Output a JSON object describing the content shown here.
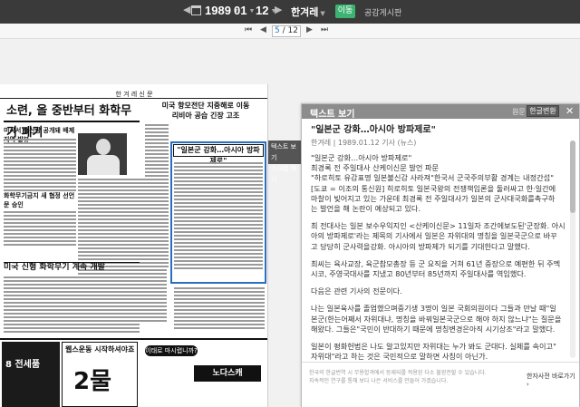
{
  "topbar": {
    "year": "1989",
    "month": "01",
    "day": "12",
    "paper": "한겨레",
    "move_label": "이동",
    "link_label": "공감게시판"
  },
  "navbar": {
    "current_page": "5",
    "total_pages": "/ 12"
  },
  "newspaper": {
    "header": "한 겨 레 신 문",
    "headline": "소련, 올 중반부터 화학무기 폐기",
    "headline2": "미국 항모전단 지중해로 이동",
    "headline2_sub": "리비아 공습 긴장 고조",
    "sub1": "미국서 생산량 공개돼 배제지역 발뷰",
    "sub2": "화학무기금지 새 협정 선언문 승인",
    "sub3": "미국 신형 화학무기 계속 개발",
    "highlight_title": "\"일본군 강화…아시아 방파제로\"",
    "ad_left": "8 전세품",
    "ad_mid_title": "웹스운동 시작하셔야죠",
    "ad_mid_big": "2물",
    "ad_right_badge": "이태로 마시렵니까?",
    "ad_right_brand": "노다스캐"
  },
  "tooltip": {
    "line1": "텍스트 보기",
    "line2": "스크랩 하기"
  },
  "panel": {
    "title": "텍스트 보기",
    "orig_label": "원문",
    "convert_label": "한글변환",
    "close_label": "✕",
    "article_title": "\"일본군 강화…아시아 방파제로\"",
    "article_meta": "한겨레 | 1989.01.12 기사 (뉴스)",
    "p1_l1": "\"일본군 강화…아시아 방파제로\"",
    "p1_l2": "최경록 전 주일대사 산케이신문 발언 파문",
    "p1_l3": "\"하로히토 유감표명 일본불신감 사라져\"한국서 군국주의부활 경계는 내정간섭\"",
    "p1_l4": "[도쿄 = 이조의 통신원] 히로히토 일본국왕의 전쟁책임론을 둘러싸고 한·일간에",
    "p1_l5": "마찰이 빚어지고 있는 가운데 최경록 전 주일대사가 일본의 군사대국화를촉구하",
    "p1_l6": "는 발언을 해 논란이 예상되고 있다.",
    "p2_l1": "최 전대사는 일본 보수우익지인 <산케이신문> 11일자 조간에보도된'군장화. 아시",
    "p2_l2": "아의 방파제로'라는 제목의 기사에서 일본은 자위대의 명칭을 일본국군으로 바꾸",
    "p2_l3": "고 당당히 군사력을강화. 아시아의 방파제가 되기를 기대한다고 말했다.",
    "p3_l1": "최씨는 육사교장, 육군참모총장 등 군 요직을 거쳐 61년 중장으로 예편한 뒤 주멕",
    "p3_l2": "시코, 주영국대사를 지냈고 80년부터 85년까지 주일대사를 역임했다.",
    "p4_l1": "다음은 관련 기사의 전문이다.",
    "p5_l1": "나는 일본육사를 졸업했으며중기생 3명이 일본 국회의원이다 그들과 만날 때\"일",
    "p5_l2": "본군(한는어째서 자위대냐, 명칭을 바꿔일본국군으로 해야 하지 않느냐\"는 질문을",
    "p5_l3": "해왔다. 그들은\"국민이 반대하기 때문에 명칭변경은아직 시기상조\"라고 말했다.",
    "p6_l1": "일본이 평화헌법은 나도 알고있지만 자위대는 누가 봐도 군대다. 실체를 속이고\"",
    "p6_l2": "자위대\"라고 하는 것은 국민적으로 말하면 사칭이 아닌가.",
    "foot1": "한국의 한글번역 시 무용합격에서 등재되를 적용된 다소 불완전할 수 있습니다.",
    "foot2": "지속적인 연구를 통해 보다 나은 서비스를 만들어 가겠습니다.",
    "foot_link": "한자사전 바로가기 ›"
  }
}
